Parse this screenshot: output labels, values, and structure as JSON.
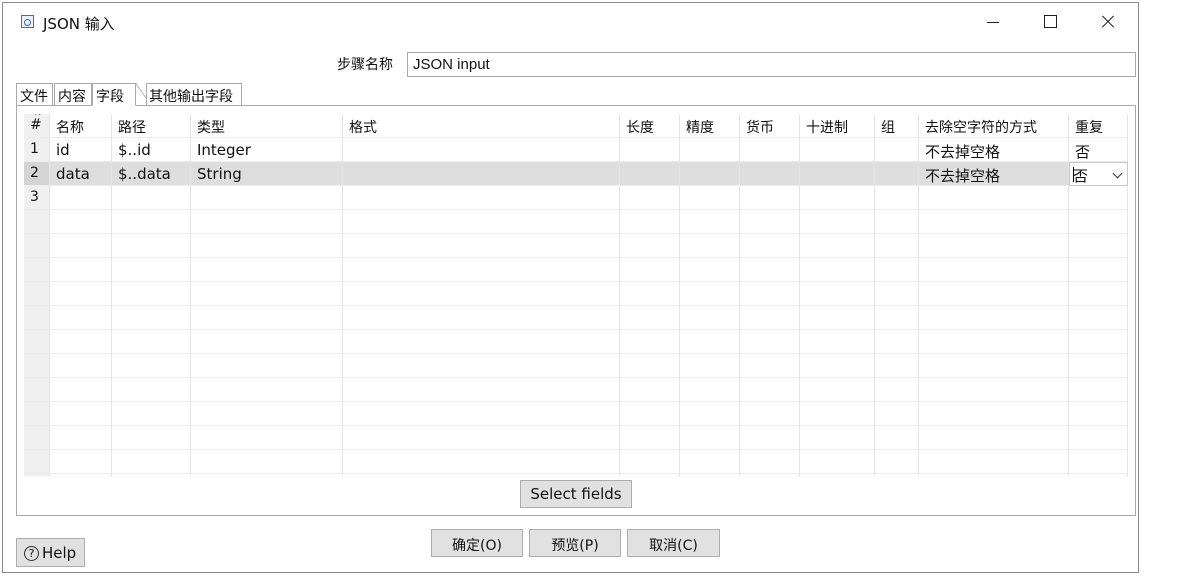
{
  "window": {
    "title": "JSON 输入"
  },
  "step": {
    "label": "步骤名称",
    "value": "JSON input"
  },
  "tabs": [
    {
      "label": "文件"
    },
    {
      "label": "内容"
    },
    {
      "label": "字段",
      "active": true
    },
    {
      "label": "其他输出字段"
    }
  ],
  "table": {
    "headers": [
      "#",
      "名称",
      "路径",
      "类型",
      "格式",
      "长度",
      "精度",
      "货币",
      "十进制",
      "组",
      "去除空字符的方式",
      "重复"
    ],
    "rows": [
      [
        "1",
        "id",
        "$..id",
        "Integer",
        "",
        "",
        "",
        "",
        "",
        "",
        "不去掉空格",
        "否"
      ],
      [
        "2",
        "data",
        "$..data",
        "String",
        "",
        "",
        "",
        "",
        "",
        "",
        "不去掉空格",
        "否"
      ],
      [
        "3",
        "",
        "",
        "",
        "",
        "",
        "",
        "",
        "",
        "",
        "",
        ""
      ]
    ],
    "selected_row": 2
  },
  "buttons": {
    "select_fields": "Select fields",
    "ok": "确定(O)",
    "preview": "预览(P)",
    "cancel": "取消(C)",
    "help": "Help"
  },
  "icons": {
    "app": "json-input-icon",
    "help": "help-circle-icon",
    "dropdown": "chevron-down-icon"
  },
  "colors": {
    "selected_row": "#dedede",
    "button_bg": "#e1e1e1"
  }
}
